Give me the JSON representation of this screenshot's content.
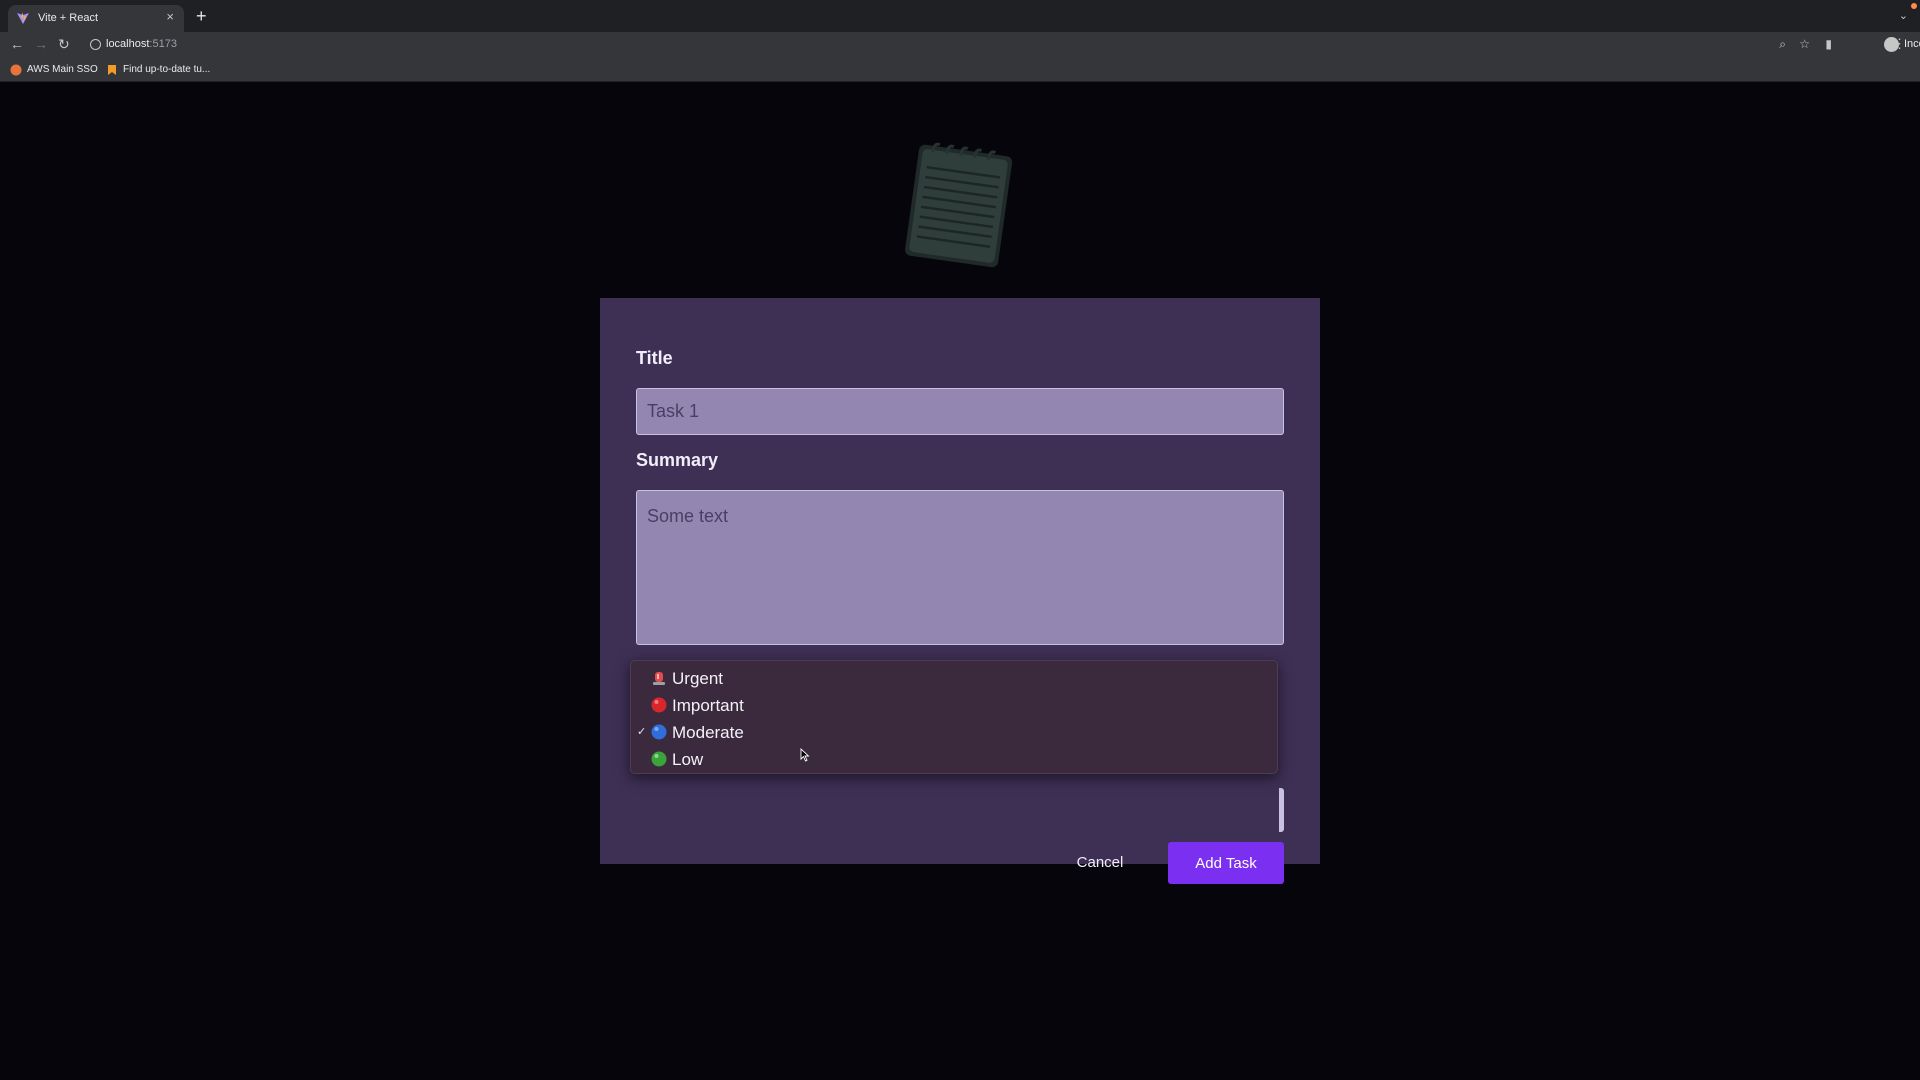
{
  "browser": {
    "tab_title": "Vite + React",
    "url_host": "localhost",
    "url_port": ":5173",
    "profile_label": "Incognito",
    "bookmarks": [
      {
        "label": "AWS Main SSO"
      },
      {
        "label": "Find up-to-date tu..."
      }
    ]
  },
  "form": {
    "title_label": "Title",
    "title_value": "Task 1",
    "summary_label": "Summary",
    "summary_value": "Some text",
    "cancel_label": "Cancel",
    "submit_label": "Add Task",
    "priority_options": [
      {
        "label": "Urgent",
        "icon": "rotating-light-icon",
        "selected": false
      },
      {
        "label": "Important",
        "icon": "red-circle-icon",
        "selected": false
      },
      {
        "label": "Moderate",
        "icon": "blue-circle-icon",
        "selected": true
      },
      {
        "label": "Low",
        "icon": "green-circle-icon",
        "selected": false
      }
    ]
  },
  "colors": {
    "modal_bg": "#3e2f54",
    "input_bg": "#9387b2",
    "accent": "#7b2ff0",
    "page_bg": "#07050c"
  }
}
